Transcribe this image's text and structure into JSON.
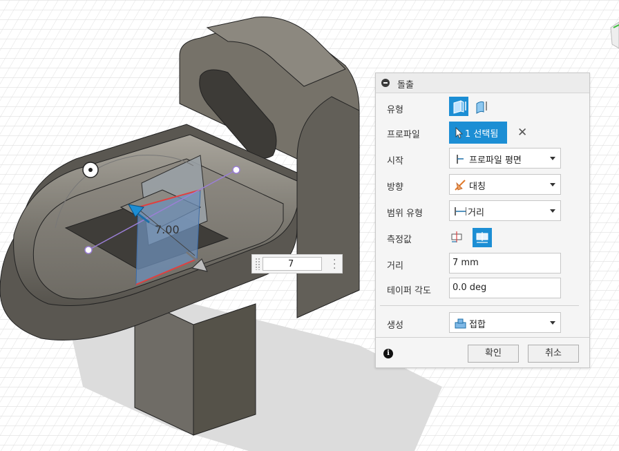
{
  "dialog": {
    "title": "돌출",
    "rows": {
      "type": {
        "label": "유형"
      },
      "profile": {
        "label": "프로파일",
        "selection": "1 선택됨"
      },
      "start": {
        "label": "시작",
        "value": "프로파일 평면"
      },
      "direction": {
        "label": "방향",
        "value": "대칭"
      },
      "extent_type": {
        "label": "범위 유형",
        "value": "거리"
      },
      "measurement": {
        "label": "측정값"
      },
      "distance": {
        "label": "거리",
        "value": "7 mm"
      },
      "taper": {
        "label": "테이퍼 각도",
        "value": "0.0 deg"
      },
      "operation": {
        "label": "생성",
        "value": "접합"
      }
    },
    "ok_label": "확인",
    "cancel_label": "취소"
  },
  "viewport": {
    "dimension_label": "7.00",
    "distance_input_value": "7"
  },
  "colors": {
    "accent": "#1c8ed4",
    "model": "#7a7770",
    "selection_face": "#6e8fb8",
    "edge_highlight": "#e04040",
    "manipulator": "#9b7fd6"
  }
}
